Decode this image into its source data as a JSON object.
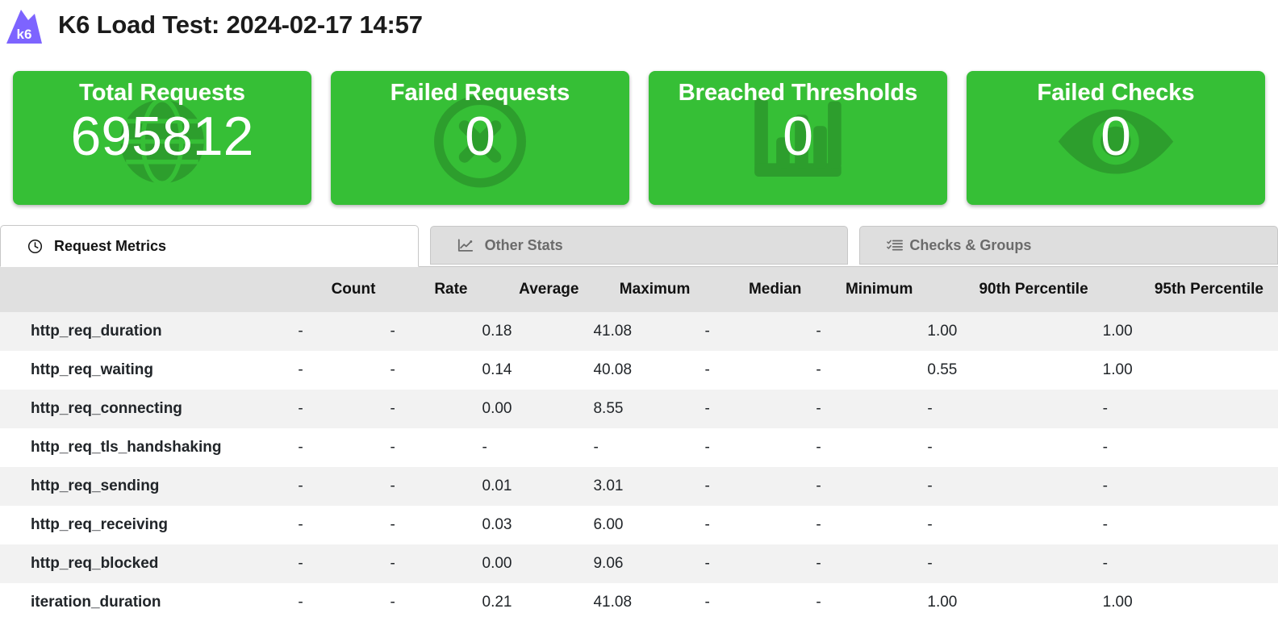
{
  "header": {
    "logo_text": "k6",
    "logo_color": "#7d64ff",
    "title": "K6 Load Test: 2024-02-17 14:57"
  },
  "cards": [
    {
      "label": "Total Requests",
      "value": "695812",
      "color": "#36bf36",
      "icon": "globe-icon"
    },
    {
      "label": "Failed Requests",
      "value": "0",
      "color": "#36bf36",
      "icon": "times-circle-icon"
    },
    {
      "label": "Breached Thresholds",
      "value": "0",
      "color": "#36bf36",
      "icon": "bar-chart-icon"
    },
    {
      "label": "Failed Checks",
      "value": "0",
      "color": "#36bf36",
      "icon": "eye-icon"
    }
  ],
  "tabs": [
    {
      "label": "Request Metrics",
      "icon": "clock-icon",
      "active": true
    },
    {
      "label": "Other Stats",
      "icon": "line-chart-icon",
      "active": false
    },
    {
      "label": "Checks & Groups",
      "icon": "tasks-icon",
      "active": false
    }
  ],
  "table": {
    "columns": [
      "",
      "Count",
      "Rate",
      "Average",
      "Maximum",
      "Median",
      "Minimum",
      "90th Percentile",
      "95th Percentile"
    ],
    "rows": [
      {
        "name": "http_req_duration",
        "count": "-",
        "rate": "-",
        "average": "0.18",
        "maximum": "41.08",
        "median": "-",
        "minimum": "-",
        "p90": "1.00",
        "p95": "1.00"
      },
      {
        "name": "http_req_waiting",
        "count": "-",
        "rate": "-",
        "average": "0.14",
        "maximum": "40.08",
        "median": "-",
        "minimum": "-",
        "p90": "0.55",
        "p95": "1.00"
      },
      {
        "name": "http_req_connecting",
        "count": "-",
        "rate": "-",
        "average": "0.00",
        "maximum": "8.55",
        "median": "-",
        "minimum": "-",
        "p90": "-",
        "p95": "-"
      },
      {
        "name": "http_req_tls_handshaking",
        "count": "-",
        "rate": "-",
        "average": "-",
        "maximum": "-",
        "median": "-",
        "minimum": "-",
        "p90": "-",
        "p95": "-"
      },
      {
        "name": "http_req_sending",
        "count": "-",
        "rate": "-",
        "average": "0.01",
        "maximum": "3.01",
        "median": "-",
        "minimum": "-",
        "p90": "-",
        "p95": "-"
      },
      {
        "name": "http_req_receiving",
        "count": "-",
        "rate": "-",
        "average": "0.03",
        "maximum": "6.00",
        "median": "-",
        "minimum": "-",
        "p90": "-",
        "p95": "-"
      },
      {
        "name": "http_req_blocked",
        "count": "-",
        "rate": "-",
        "average": "0.00",
        "maximum": "9.06",
        "median": "-",
        "minimum": "-",
        "p90": "-",
        "p95": "-"
      },
      {
        "name": "iteration_duration",
        "count": "-",
        "rate": "-",
        "average": "0.21",
        "maximum": "41.08",
        "median": "-",
        "minimum": "-",
        "p90": "1.00",
        "p95": "1.00"
      }
    ]
  }
}
